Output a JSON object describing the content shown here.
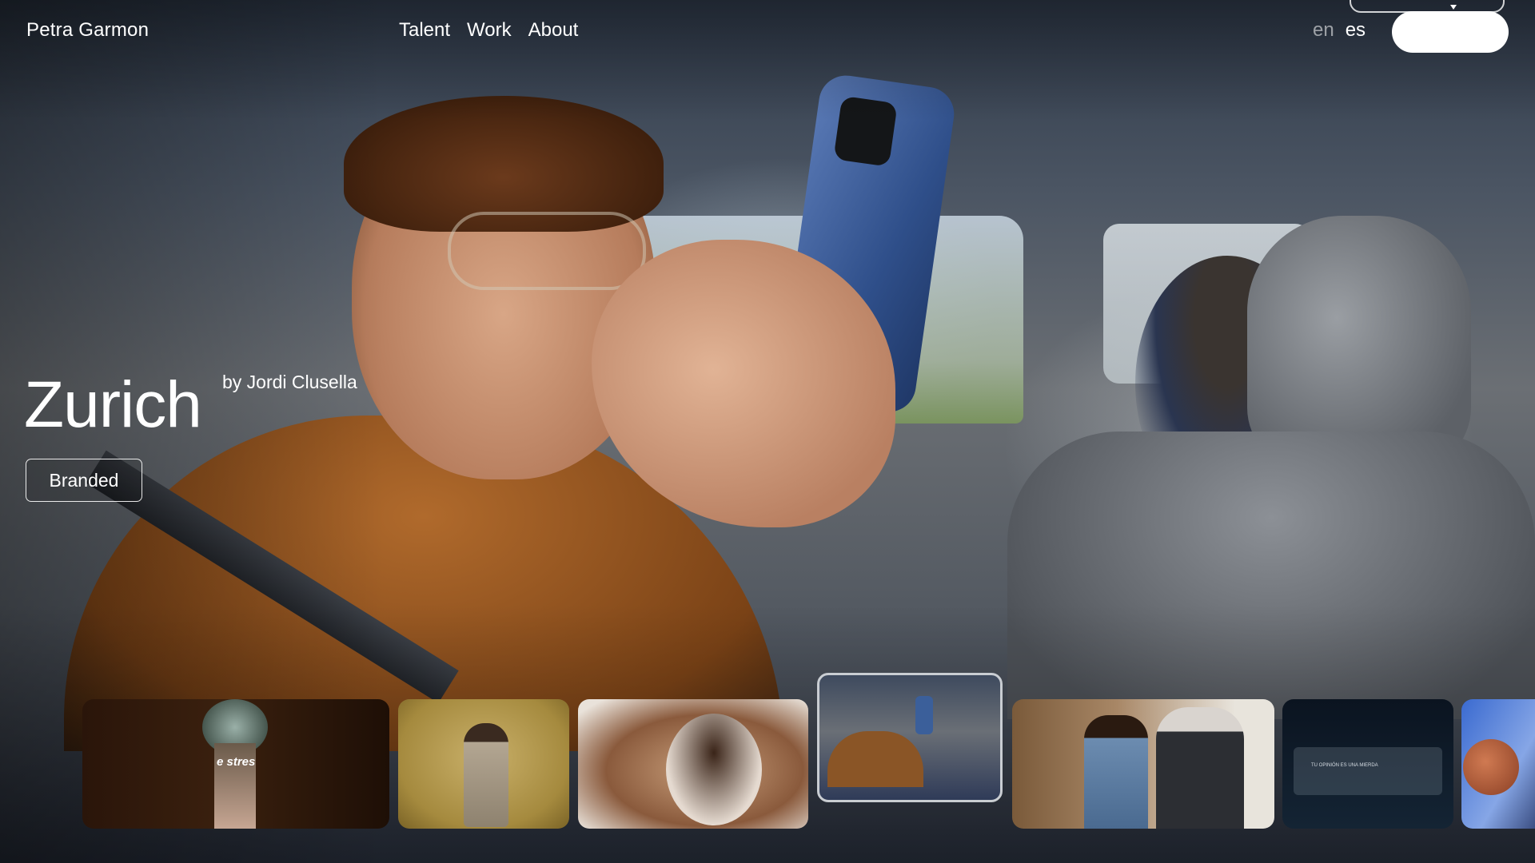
{
  "header": {
    "brand": "Petra Garmon",
    "nav": [
      {
        "label": "Talent"
      },
      {
        "label": "Work"
      },
      {
        "label": "About"
      }
    ],
    "languages": [
      {
        "label": "en",
        "active": false
      },
      {
        "label": "es",
        "active": true
      }
    ]
  },
  "hero": {
    "title": "Zurich",
    "byline": "by Jordi Clusella",
    "tag": "Branded"
  },
  "thumbnails": [
    {
      "overlay_text": "e stres"
    },
    {
      "overlay_text": ""
    },
    {
      "overlay_text": ""
    },
    {
      "overlay_text": ""
    },
    {
      "overlay_text": ""
    },
    {
      "overlay_text": "TU OPINIÓN ES UNA MIERDA"
    },
    {
      "overlay_text": ""
    }
  ],
  "colors": {
    "text": "#ffffff",
    "inactive_lang": "#b3b3b3",
    "accent_button": "#ffffff"
  }
}
